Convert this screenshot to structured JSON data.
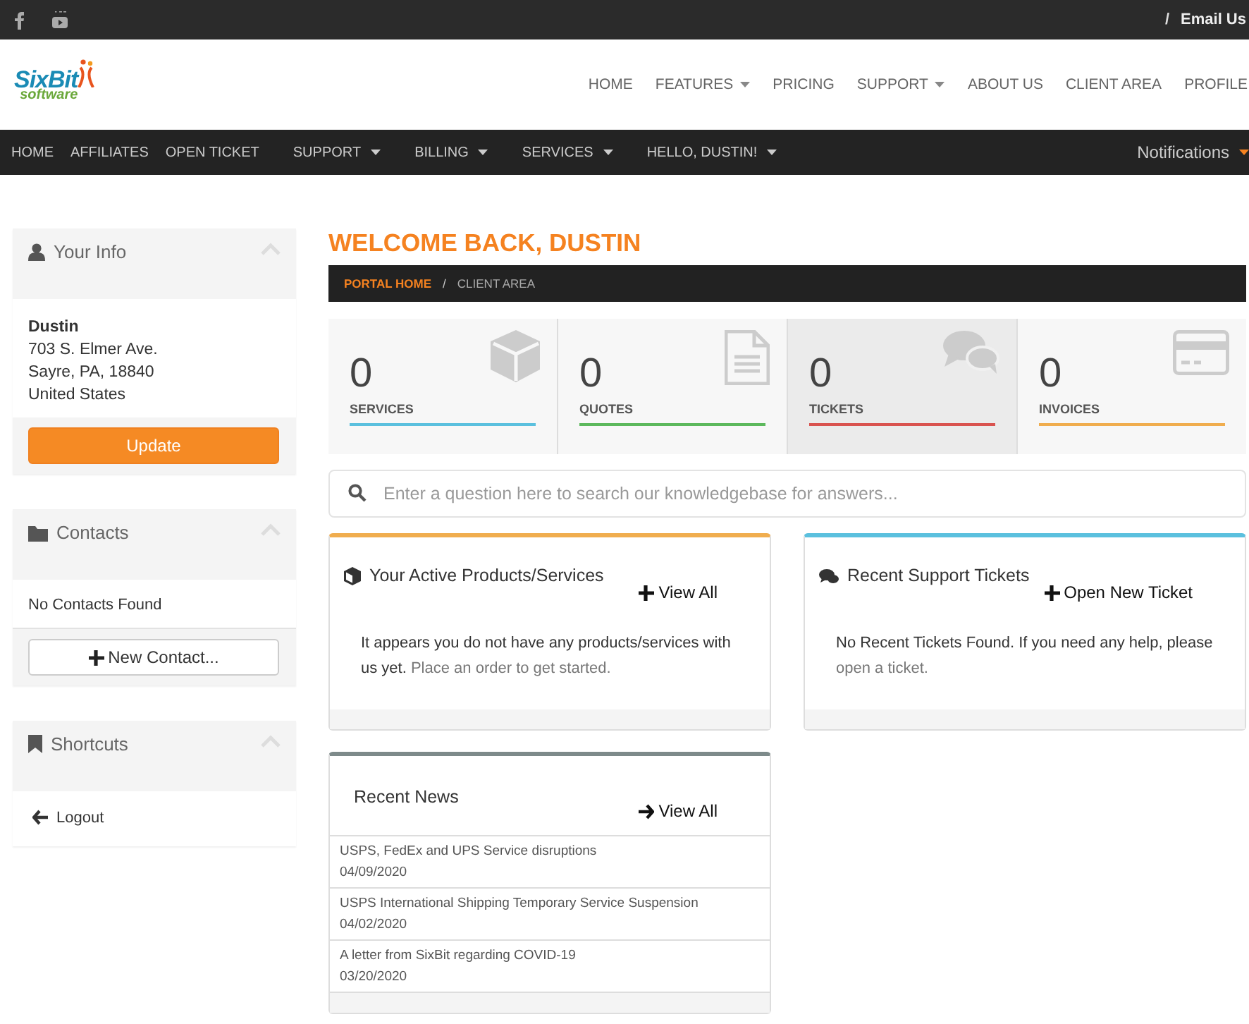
{
  "top_bar": {
    "separator": "/",
    "link": "Email Us"
  },
  "logo": {
    "name": "SixBit",
    "tagline": "software"
  },
  "main_menu": [
    {
      "label": "HOME",
      "dropdown": false
    },
    {
      "label": "FEATURES",
      "dropdown": true
    },
    {
      "label": "PRICING",
      "dropdown": false
    },
    {
      "label": "SUPPORT",
      "dropdown": true
    },
    {
      "label": "ABOUT US",
      "dropdown": false
    },
    {
      "label": "CLIENT AREA",
      "dropdown": false
    },
    {
      "label": "PROFILE",
      "dropdown": false
    }
  ],
  "client_nav": {
    "items": [
      {
        "label": "HOME",
        "dropdown": false
      },
      {
        "label": "AFFILIATES",
        "dropdown": false
      },
      {
        "label": "OPEN TICKET",
        "dropdown": false
      },
      {
        "label": "SUPPORT",
        "dropdown": true
      },
      {
        "label": "BILLING",
        "dropdown": true
      },
      {
        "label": "SERVICES",
        "dropdown": true
      },
      {
        "label": "HELLO, DUSTIN!",
        "dropdown": true
      }
    ],
    "notifications": "Notifications"
  },
  "sidebar": [
    {
      "kind": "info",
      "title": "Your Info",
      "name": "Dustin",
      "lines": [
        "703 S. Elmer Ave.",
        "Sayre, PA, 18840",
        "United States"
      ],
      "button": "Update"
    },
    {
      "kind": "contacts",
      "title": "Contacts",
      "text": "No Contacts Found",
      "button": "New Contact..."
    },
    {
      "kind": "shortcuts",
      "title": "Shortcuts",
      "links": [
        "Logout"
      ]
    }
  ],
  "welcome": "WELCOME BACK, DUSTIN",
  "breadcrumb_separator": "/",
  "breadcrumb": [
    {
      "label": "PORTAL HOME",
      "current": false
    },
    {
      "label": "CLIENT AREA",
      "current": true
    }
  ],
  "stats": [
    {
      "kind": "services",
      "count": "0",
      "label": "SERVICES",
      "color": "#5bc0de",
      "highlighted": false
    },
    {
      "kind": "quotes",
      "count": "0",
      "label": "QUOTES",
      "color": "#5cb85c",
      "highlighted": false
    },
    {
      "kind": "tickets",
      "count": "0",
      "label": "TICKETS",
      "color": "#d9534f",
      "highlighted": true
    },
    {
      "kind": "invoices",
      "count": "0",
      "label": "INVOICES",
      "color": "#f0ad4e",
      "highlighted": false
    }
  ],
  "search": {
    "placeholder": "Enter a question here to search our knowledgebase for answers..."
  },
  "panels": [
    {
      "kind": "products",
      "title": "Your Active Products/Services",
      "action": "View All",
      "text": "It appears you do not have any products/services with us yet.",
      "link": "Place an order to get started.",
      "color": "#f0ad4e"
    },
    {
      "kind": "tickets",
      "title": "Recent Support Tickets",
      "action": "Open New Ticket",
      "text": "No Recent Tickets Found. If you need any help, please",
      "link": "open a ticket.",
      "color": "#5bc0de"
    }
  ],
  "news": {
    "title": "Recent News",
    "action": "View All",
    "items": [
      {
        "title": "USPS, FedEx and UPS Service disruptions",
        "date": "04/09/2020"
      },
      {
        "title": "USPS International Shipping Temporary Service Suspension",
        "date": "04/02/2020"
      },
      {
        "title": "A letter from SixBit regarding COVID-19",
        "date": "03/20/2020"
      }
    ]
  }
}
